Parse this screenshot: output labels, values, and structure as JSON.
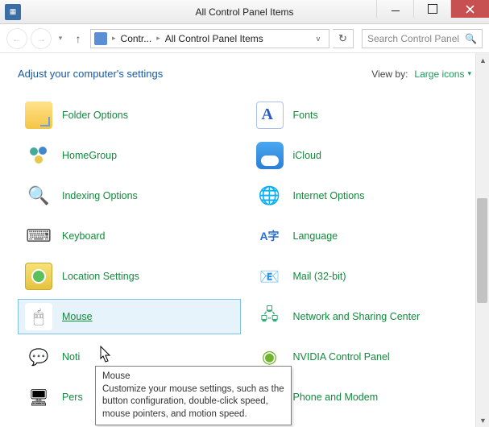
{
  "window": {
    "title": "All Control Panel Items"
  },
  "address": {
    "crumb1": "Contr...",
    "crumb2": "All Control Panel Items"
  },
  "search": {
    "placeholder": "Search Control Panel"
  },
  "header": {
    "heading": "Adjust your computer's settings",
    "viewby_label": "View by:",
    "viewby_value": "Large icons"
  },
  "items": [
    {
      "label": "Folder Options",
      "icon": "folder"
    },
    {
      "label": "Fonts",
      "icon": "fonts"
    },
    {
      "label": "HomeGroup",
      "icon": "homegroup"
    },
    {
      "label": "iCloud",
      "icon": "icloud"
    },
    {
      "label": "Indexing Options",
      "icon": "indexing"
    },
    {
      "label": "Internet Options",
      "icon": "internet"
    },
    {
      "label": "Keyboard",
      "icon": "keyboard"
    },
    {
      "label": "Language",
      "icon": "language"
    },
    {
      "label": "Location Settings",
      "icon": "location"
    },
    {
      "label": "Mail (32-bit)",
      "icon": "mail"
    },
    {
      "label": "Mouse",
      "icon": "mouse",
      "hover": true
    },
    {
      "label": "Network and Sharing Center",
      "icon": "network"
    },
    {
      "label": "Noti",
      "icon": "noti",
      "truncated": true
    },
    {
      "label": "NVIDIA Control Panel",
      "icon": "nvidia"
    },
    {
      "label": "Pers",
      "icon": "perso",
      "truncated": true
    },
    {
      "label": "Phone and Modem",
      "icon": "phone"
    }
  ],
  "tooltip": {
    "title": "Mouse",
    "body": "Customize your mouse settings, such as the button configuration, double-click speed, mouse pointers, and motion speed."
  }
}
